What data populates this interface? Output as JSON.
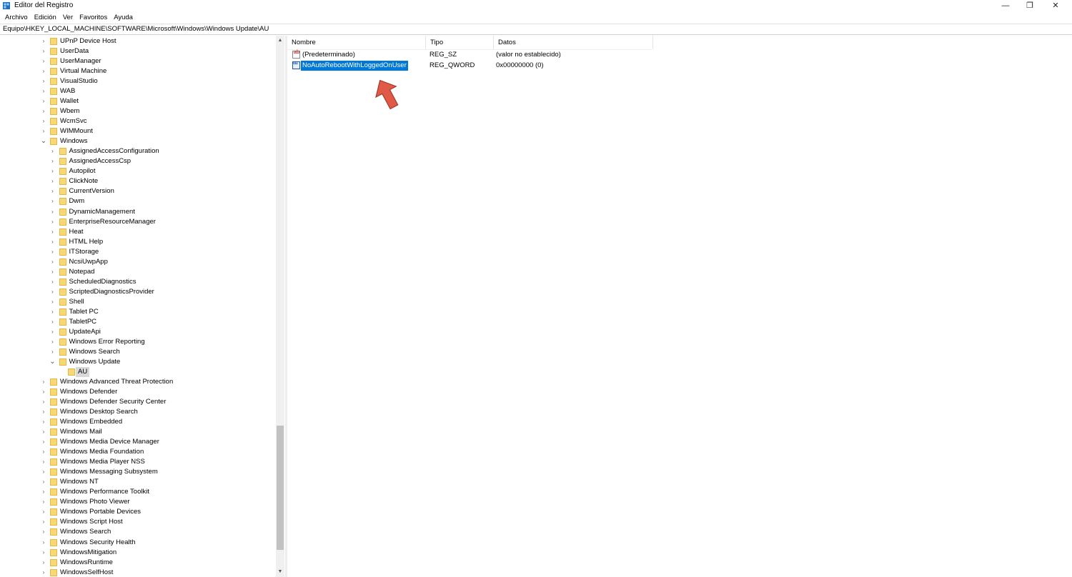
{
  "window": {
    "title": "Editor del Registro",
    "minimize": "—",
    "restore": "❐",
    "close": "✕"
  },
  "menu": [
    "Archivo",
    "Edición",
    "Ver",
    "Favoritos",
    "Ayuda"
  ],
  "address": "Equipo\\HKEY_LOCAL_MACHINE\\SOFTWARE\\Microsoft\\Windows\\Windows Update\\AU",
  "tree": {
    "items": [
      {
        "label": "UPnP Device Host",
        "level": 1,
        "state": "collapsed"
      },
      {
        "label": "UserData",
        "level": 1,
        "state": "collapsed"
      },
      {
        "label": "UserManager",
        "level": 1,
        "state": "collapsed"
      },
      {
        "label": "Virtual Machine",
        "level": 1,
        "state": "collapsed"
      },
      {
        "label": "VisualStudio",
        "level": 1,
        "state": "collapsed"
      },
      {
        "label": "WAB",
        "level": 1,
        "state": "collapsed"
      },
      {
        "label": "Wallet",
        "level": 1,
        "state": "collapsed"
      },
      {
        "label": "Wbem",
        "level": 1,
        "state": "collapsed"
      },
      {
        "label": "WcmSvc",
        "level": 1,
        "state": "collapsed"
      },
      {
        "label": "WIMMount",
        "level": 1,
        "state": "collapsed"
      },
      {
        "label": "Windows",
        "level": 1,
        "state": "expanded"
      },
      {
        "label": "AssignedAccessConfiguration",
        "level": 2,
        "state": "collapsed"
      },
      {
        "label": "AssignedAccessCsp",
        "level": 2,
        "state": "collapsed"
      },
      {
        "label": "Autopilot",
        "level": 2,
        "state": "collapsed"
      },
      {
        "label": "ClickNote",
        "level": 2,
        "state": "collapsed"
      },
      {
        "label": "CurrentVersion",
        "level": 2,
        "state": "collapsed"
      },
      {
        "label": "Dwm",
        "level": 2,
        "state": "collapsed"
      },
      {
        "label": "DynamicManagement",
        "level": 2,
        "state": "collapsed"
      },
      {
        "label": "EnterpriseResourceManager",
        "level": 2,
        "state": "collapsed"
      },
      {
        "label": "Heat",
        "level": 2,
        "state": "collapsed"
      },
      {
        "label": "HTML Help",
        "level": 2,
        "state": "collapsed"
      },
      {
        "label": "ITStorage",
        "level": 2,
        "state": "collapsed"
      },
      {
        "label": "NcsiUwpApp",
        "level": 2,
        "state": "collapsed"
      },
      {
        "label": "Notepad",
        "level": 2,
        "state": "collapsed"
      },
      {
        "label": "ScheduledDiagnostics",
        "level": 2,
        "state": "collapsed"
      },
      {
        "label": "ScriptedDiagnosticsProvider",
        "level": 2,
        "state": "collapsed"
      },
      {
        "label": "Shell",
        "level": 2,
        "state": "collapsed"
      },
      {
        "label": "Tablet PC",
        "level": 2,
        "state": "collapsed"
      },
      {
        "label": "TabletPC",
        "level": 2,
        "state": "collapsed"
      },
      {
        "label": "UpdateApi",
        "level": 2,
        "state": "collapsed"
      },
      {
        "label": "Windows Error Reporting",
        "level": 2,
        "state": "collapsed"
      },
      {
        "label": "Windows Search",
        "level": 2,
        "state": "collapsed"
      },
      {
        "label": "Windows Update",
        "level": 2,
        "state": "expanded"
      },
      {
        "label": "AU",
        "level": 3,
        "state": "leaf",
        "selected": true
      },
      {
        "label": "Windows Advanced Threat Protection",
        "level": 1,
        "state": "collapsed"
      },
      {
        "label": "Windows Defender",
        "level": 1,
        "state": "collapsed"
      },
      {
        "label": "Windows Defender Security Center",
        "level": 1,
        "state": "collapsed"
      },
      {
        "label": "Windows Desktop Search",
        "level": 1,
        "state": "collapsed"
      },
      {
        "label": "Windows Embedded",
        "level": 1,
        "state": "collapsed"
      },
      {
        "label": "Windows Mail",
        "level": 1,
        "state": "collapsed"
      },
      {
        "label": "Windows Media Device Manager",
        "level": 1,
        "state": "collapsed"
      },
      {
        "label": "Windows Media Foundation",
        "level": 1,
        "state": "collapsed"
      },
      {
        "label": "Windows Media Player NSS",
        "level": 1,
        "state": "collapsed"
      },
      {
        "label": "Windows Messaging Subsystem",
        "level": 1,
        "state": "collapsed"
      },
      {
        "label": "Windows NT",
        "level": 1,
        "state": "collapsed"
      },
      {
        "label": "Windows Performance Toolkit",
        "level": 1,
        "state": "collapsed"
      },
      {
        "label": "Windows Photo Viewer",
        "level": 1,
        "state": "collapsed"
      },
      {
        "label": "Windows Portable Devices",
        "level": 1,
        "state": "collapsed"
      },
      {
        "label": "Windows Script Host",
        "level": 1,
        "state": "collapsed"
      },
      {
        "label": "Windows Search",
        "level": 1,
        "state": "collapsed"
      },
      {
        "label": "Windows Security Health",
        "level": 1,
        "state": "collapsed"
      },
      {
        "label": "WindowsMitigation",
        "level": 1,
        "state": "collapsed"
      },
      {
        "label": "WindowsRuntime",
        "level": 1,
        "state": "collapsed"
      },
      {
        "label": "WindowsSelfHost",
        "level": 1,
        "state": "collapsed"
      }
    ]
  },
  "list": {
    "columns": {
      "name": "Nombre",
      "type": "Tipo",
      "data": "Datos"
    },
    "rows": [
      {
        "name": "(Predeterminado)",
        "type": "REG_SZ",
        "data": "(valor no establecido)",
        "icon": "string-value-icon",
        "glyph": "ab",
        "selected": false
      },
      {
        "name": "NoAutoRebootWithLoggedOnUser",
        "type": "REG_QWORD",
        "data": "0x00000000 (0)",
        "icon": "binary-value-icon",
        "glyph": "011",
        "selected": true
      }
    ]
  },
  "colors": {
    "selection": "#0078d7",
    "folder": "#f8d775",
    "arrow": "#e05a47"
  }
}
